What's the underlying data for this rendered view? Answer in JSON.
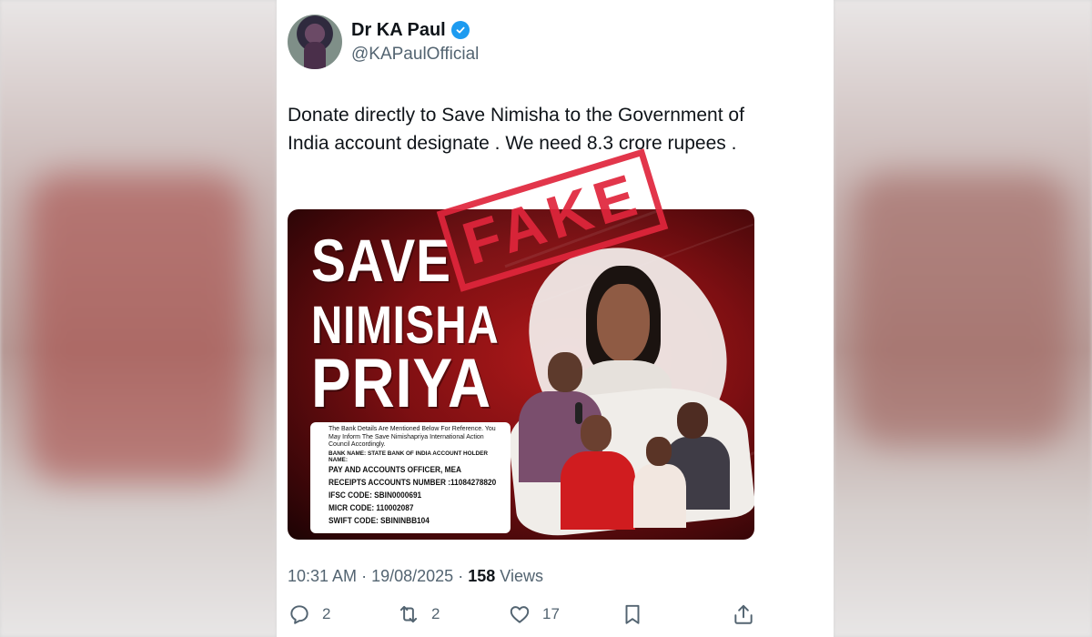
{
  "tweet": {
    "display_name": "Dr KA Paul",
    "handle": "@KAPaulOfficial",
    "text": "Donate directly to Save Nimisha to the Government of India account designate . We need 8.3 crore rupees .",
    "time": "10:31 AM",
    "date": "19/08/2025",
    "views_count": "158",
    "views_label": "Views",
    "separator": "·"
  },
  "image": {
    "title_line1": "SAVE",
    "title_line2": "NIMISHA",
    "title_line3": "PRIYA",
    "stamp": "FAKE",
    "bank_ref": "The Bank Details Are Mentioned Below For Reference. You May Inform The Save Nimishapriya International Action Council Accordingly.",
    "bank_name_line": "BANK NAME: STATE BANK OF INDIA ACCOUNT HOLDER NAME:",
    "holder": "PAY AND ACCOUNTS OFFICER, MEA",
    "account": "RECEIPTS ACCOUNTS NUMBER :11084278820",
    "ifsc": "IFSC CODE:   SBIN0000691",
    "micr": "MICR CODE:      110002087",
    "swift": "SWIFT CODE:   SBININBB104"
  },
  "actions": {
    "replies": "2",
    "reposts": "2",
    "likes": "17"
  },
  "icons": {
    "verified": "verified-badge-icon",
    "reply": "reply-icon",
    "repost": "repost-icon",
    "like": "heart-icon",
    "bookmark": "bookmark-icon",
    "share": "share-icon"
  },
  "colors": {
    "accent": "#1d9bf0",
    "stamp": "#e0263c",
    "text": "#0f1419",
    "muted": "#536471"
  }
}
